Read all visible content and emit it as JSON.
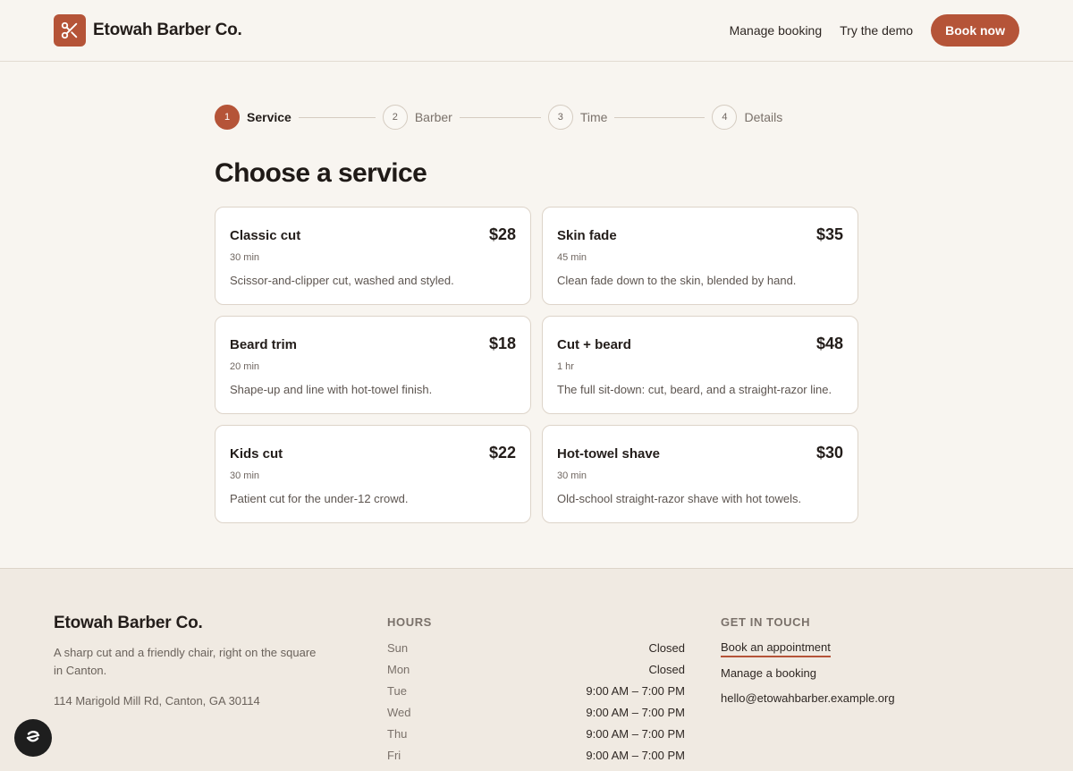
{
  "header": {
    "brand_name": "Etowah Barber Co.",
    "nav": {
      "manage_booking": "Manage booking",
      "try_demo": "Try the demo",
      "book_now": "Book now"
    }
  },
  "stepper": {
    "steps": [
      {
        "num": "1",
        "label": "Service",
        "active": true
      },
      {
        "num": "2",
        "label": "Barber",
        "active": false
      },
      {
        "num": "3",
        "label": "Time",
        "active": false
      },
      {
        "num": "4",
        "label": "Details",
        "active": false
      }
    ]
  },
  "main": {
    "title": "Choose a service",
    "services": [
      {
        "name": "Classic cut",
        "price": "$28",
        "duration": "30 min",
        "description": "Scissor-and-clipper cut, washed and styled."
      },
      {
        "name": "Skin fade",
        "price": "$35",
        "duration": "45 min",
        "description": "Clean fade down to the skin, blended by hand."
      },
      {
        "name": "Beard trim",
        "price": "$18",
        "duration": "20 min",
        "description": "Shape-up and line with hot-towel finish."
      },
      {
        "name": "Cut + beard",
        "price": "$48",
        "duration": "1 hr",
        "description": "The full sit-down: cut, beard, and a straight-razor line."
      },
      {
        "name": "Kids cut",
        "price": "$22",
        "duration": "30 min",
        "description": "Patient cut for the under-12 crowd."
      },
      {
        "name": "Hot-towel shave",
        "price": "$30",
        "duration": "30 min",
        "description": "Old-school straight-razor shave with hot towels."
      }
    ]
  },
  "footer": {
    "brand_name": "Etowah Barber Co.",
    "tagline": "A sharp cut and a friendly chair, right on the square in Canton.",
    "address": "114 Marigold Mill Rd, Canton, GA 30114",
    "hours_heading": "HOURS",
    "hours": [
      {
        "day": "Sun",
        "time": "Closed"
      },
      {
        "day": "Mon",
        "time": "Closed"
      },
      {
        "day": "Tue",
        "time": "9:00 AM – 7:00 PM"
      },
      {
        "day": "Wed",
        "time": "9:00 AM – 7:00 PM"
      },
      {
        "day": "Thu",
        "time": "9:00 AM – 7:00 PM"
      },
      {
        "day": "Fri",
        "time": "9:00 AM – 7:00 PM"
      }
    ],
    "contact_heading": "GET IN TOUCH",
    "links": {
      "book_appointment": "Book an appointment",
      "manage_booking": "Manage a booking",
      "email": "hello@etowahbarber.example.org"
    }
  },
  "colors": {
    "accent": "#b55438",
    "background": "#f8f5f0",
    "footer_background": "#f0eae2"
  },
  "icons": {
    "brand": "scissors-icon",
    "floating": "chat-widget-icon"
  }
}
